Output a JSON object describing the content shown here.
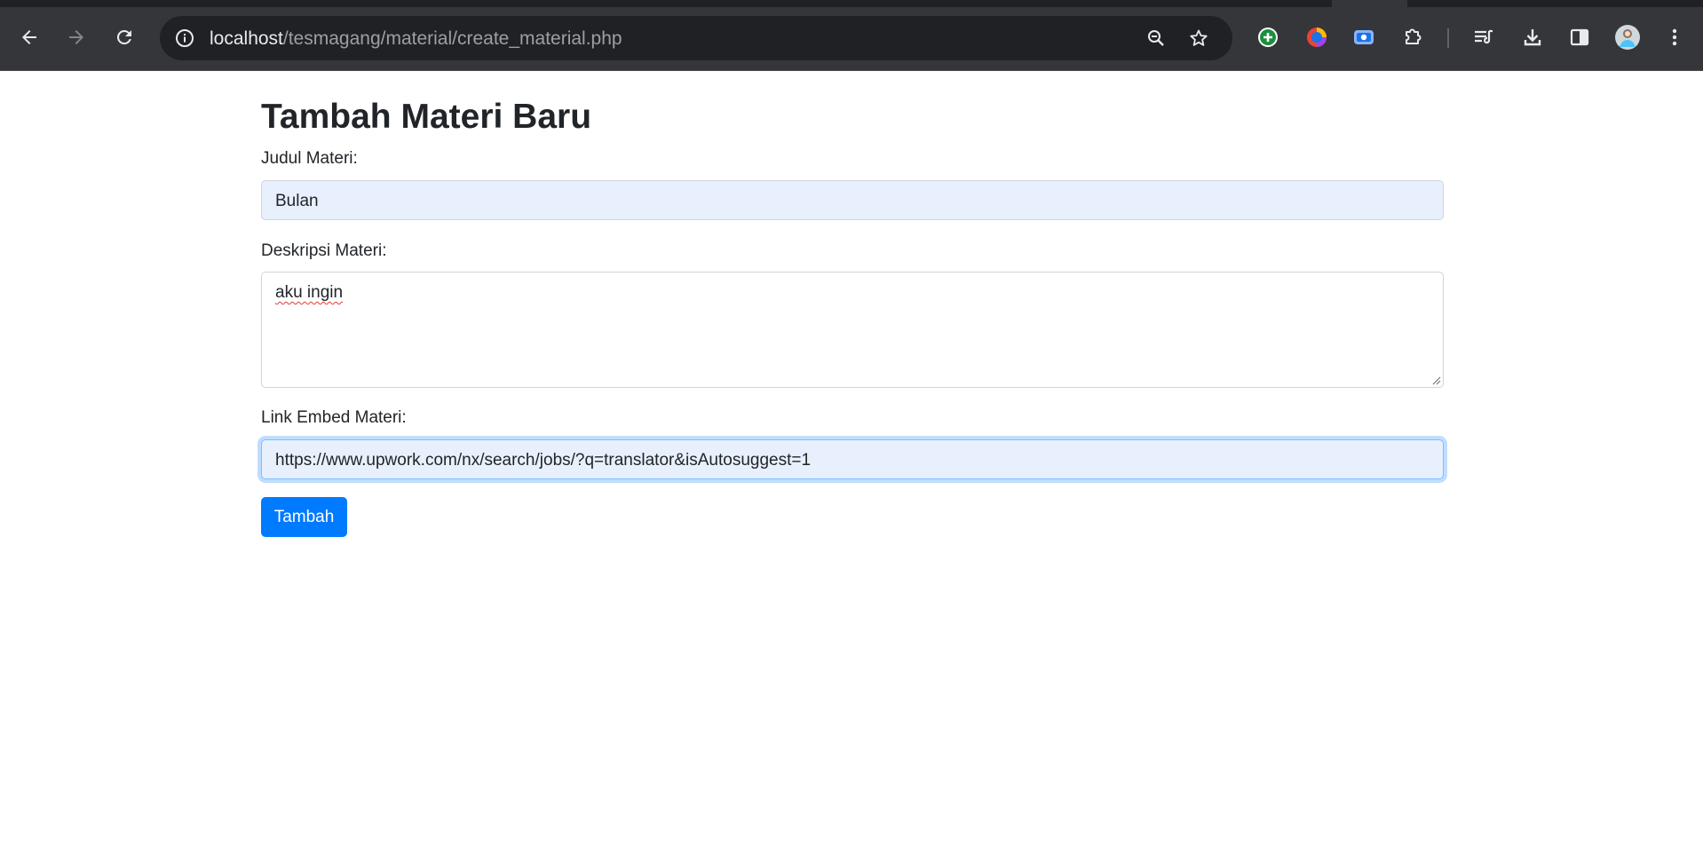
{
  "browser": {
    "url_host": "localhost",
    "url_path": "/tesmagang/material/create_material.php",
    "icons": [
      "back-icon",
      "forward-icon",
      "reload-icon",
      "site-info-icon",
      "zoom-icon",
      "bookmark-star-icon",
      "add-extension-icon",
      "color-extension-icon",
      "screen-capture-icon",
      "extensions-puzzle-icon",
      "reading-list-icon",
      "download-icon",
      "side-panel-icon",
      "profile-avatar",
      "menu-kebab-icon"
    ]
  },
  "page": {
    "title": "Tambah Materi Baru",
    "form": {
      "title_label": "Judul Materi:",
      "title_value": "Bulan",
      "description_label": "Deskripsi Materi:",
      "description_value": "aku ingin",
      "link_label": "Link Embed Materi:",
      "link_value": "https://www.upwork.com/nx/search/jobs/?q=translator&isAutosuggest=1",
      "submit_label": "Tambah"
    }
  },
  "colors": {
    "chrome_toolbar": "#35363a",
    "omnibox": "#202124",
    "primary_button": "#007bff",
    "autofill_bg": "#e8f0fe",
    "text": "#212529"
  }
}
